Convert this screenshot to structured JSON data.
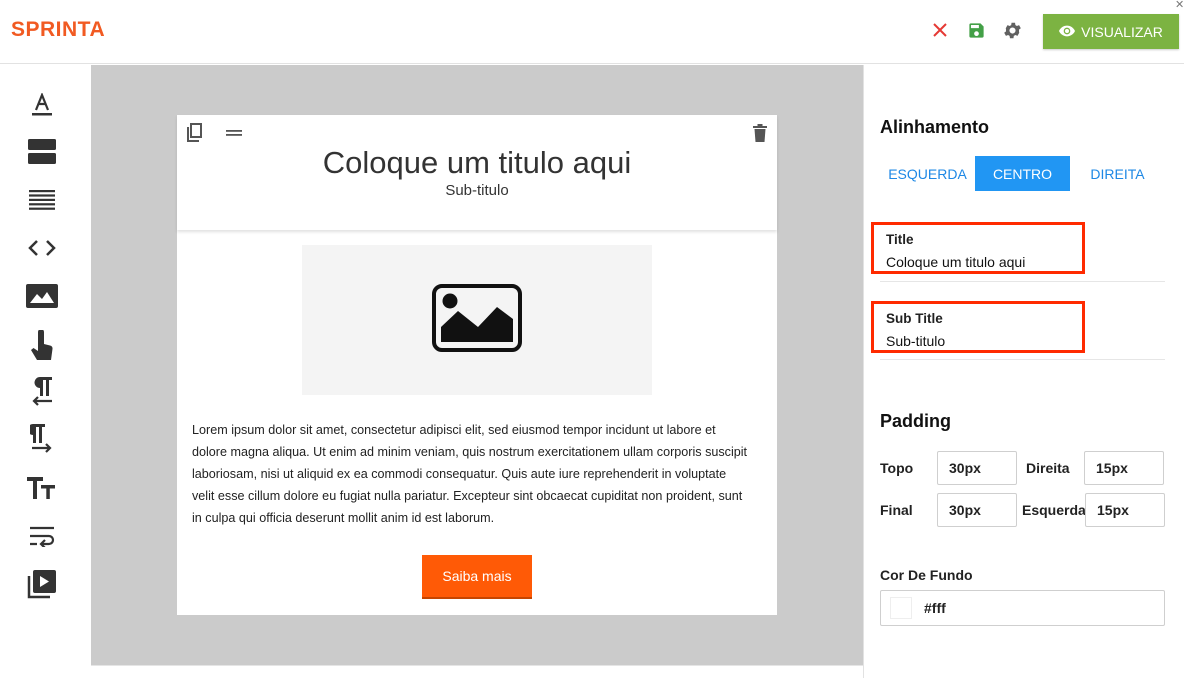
{
  "app": {
    "brand": "SPRINTA"
  },
  "toolbar": {
    "view_label": "VISUALIZAR",
    "icons": [
      "close-icon",
      "save-icon",
      "settings-icon",
      "eye-icon"
    ],
    "colors": {
      "close": "#e53935",
      "save": "#43a047",
      "settings": "#616161",
      "view_button": "#7cb342",
      "brand": "#f15a22"
    }
  },
  "sidebar": {
    "tools": [
      "text-format-icon",
      "section-icon",
      "paragraph-lines-icon",
      "code-icon",
      "image-icon",
      "touch-icon",
      "text-direction-left-icon",
      "text-direction-right-icon",
      "text-size-icon",
      "text-wrap-icon",
      "video-library-icon"
    ]
  },
  "card": {
    "title": "Coloque um titulo aqui",
    "subtitle": "Sub-titulo",
    "body": "Lorem ipsum dolor sit amet, consectetur adipisci elit, sed eiusmod tempor incidunt ut labore et dolore magna aliqua. Ut enim ad minim veniam, quis nostrum exercitationem ullam corporis suscipit laboriosam, nisi ut aliquid ex ea commodi consequatur. Quis aute iure reprehenderit in voluptate velit esse cillum dolore eu fugiat nulla pariatur. Excepteur sint obcaecat cupiditat non proident, sunt in culpa qui officia deserunt mollit anim id est laborum.",
    "button_label": "Saiba mais",
    "button_color": "#ff5a06"
  },
  "panel": {
    "alignment": {
      "title": "Alinhamento",
      "options": [
        "ESQUERDA",
        "CENTRO",
        "DIREITA"
      ],
      "selected": "CENTRO"
    },
    "fields": {
      "title": {
        "label": "Title",
        "value": "Coloque um titulo aqui"
      },
      "subtitle": {
        "label": "Sub Title",
        "value": "Sub-titulo"
      }
    },
    "padding": {
      "title": "Padding",
      "top_label": "Topo",
      "top_value": "30px",
      "right_label": "Direita",
      "right_value": "15px",
      "bottom_label": "Final",
      "bottom_value": "30px",
      "left_label": "Esquerda",
      "left_value": "15px"
    },
    "background": {
      "label": "Cor De Fundo",
      "value": "#fff"
    }
  }
}
